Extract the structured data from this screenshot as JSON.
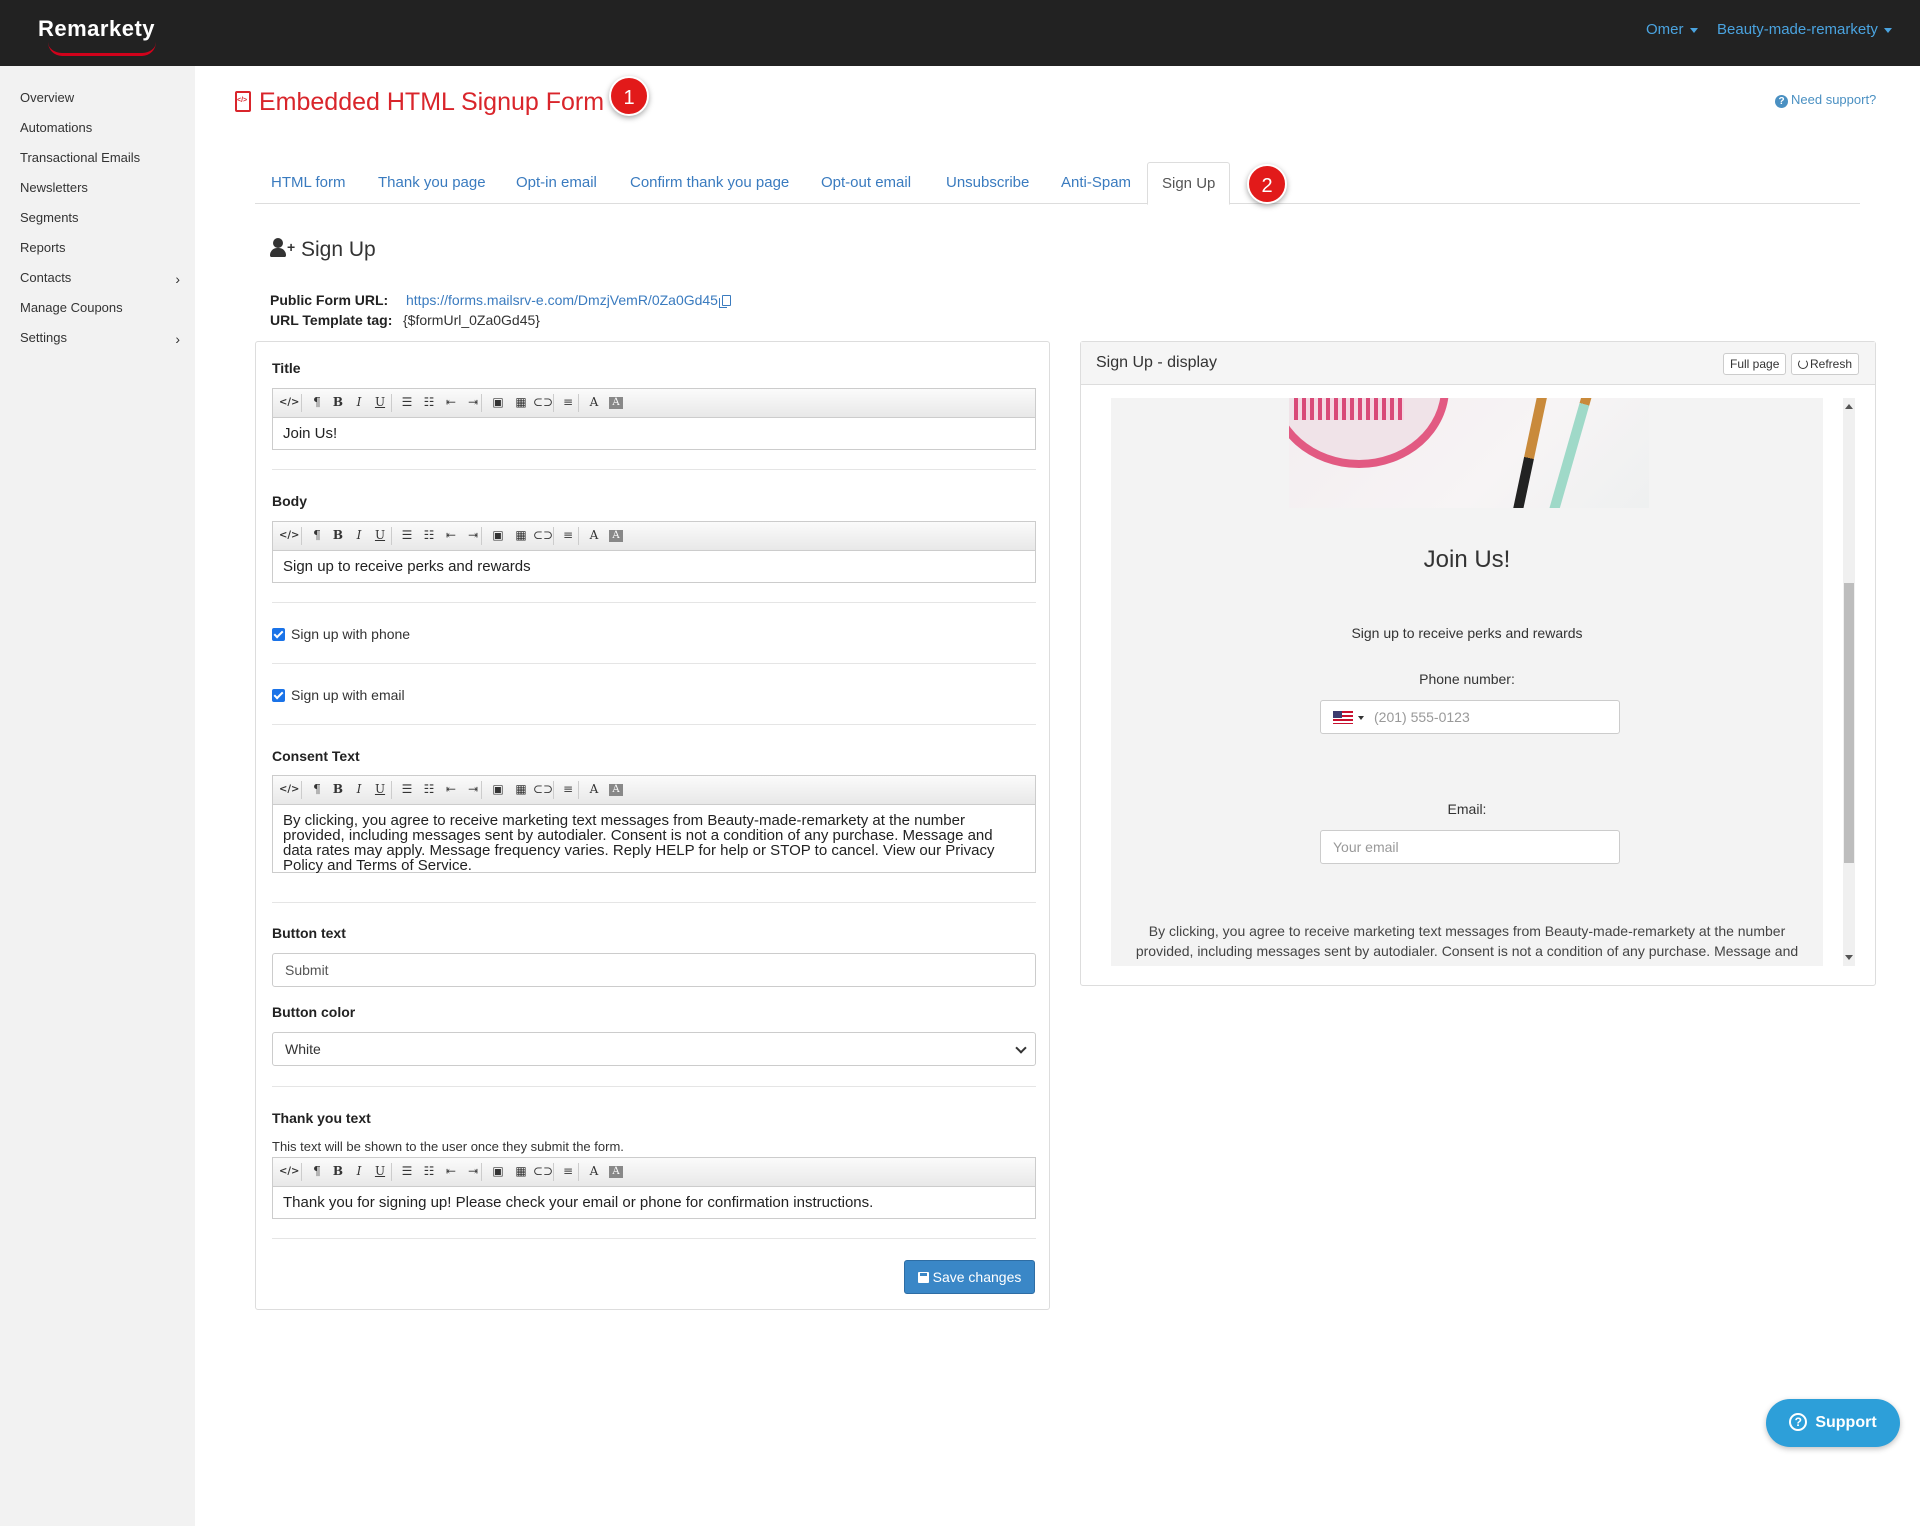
{
  "topbar": {
    "logo": "Remarkety",
    "user": "Omer",
    "account": "Beauty-made-remarkety"
  },
  "sidebar": {
    "items": [
      {
        "label": "Overview"
      },
      {
        "label": "Automations"
      },
      {
        "label": "Transactional Emails"
      },
      {
        "label": "Newsletters"
      },
      {
        "label": "Segments"
      },
      {
        "label": "Reports"
      },
      {
        "label": "Contacts",
        "chevron": "›"
      },
      {
        "label": "Manage Coupons"
      },
      {
        "label": "Settings",
        "chevron": "›"
      }
    ]
  },
  "header": {
    "title": "Embedded HTML Signup Form",
    "need_support": "Need support?",
    "badge1": "1",
    "badge2": "2"
  },
  "tabs": [
    {
      "label": "HTML form"
    },
    {
      "label": "Thank you page"
    },
    {
      "label": "Opt-in email"
    },
    {
      "label": "Confirm thank you page"
    },
    {
      "label": "Opt-out email"
    },
    {
      "label": "Unsubscribe"
    },
    {
      "label": "Anti-Spam"
    },
    {
      "label": "Sign Up",
      "active": true
    }
  ],
  "section": {
    "title": "Sign Up",
    "public_form_url_label": "Public Form URL:",
    "public_form_url": "https://forms.mailsrv-e.com/DmzjVemR/0Za0Gd45",
    "url_template_label": "URL Template tag:",
    "url_template": "{$formUrl_0Za0Gd45}"
  },
  "form": {
    "title_label": "Title",
    "title_value": "Join Us!",
    "body_label": "Body",
    "body_value": "Sign up to receive perks and rewards",
    "phone_checkbox": "Sign up with phone",
    "phone_checked": true,
    "email_checkbox": "Sign up with email",
    "email_checked": true,
    "consent_label": "Consent Text",
    "consent_value": "By clicking, you agree to receive marketing text messages from Beauty-made-remarkety at the number provided, including messages sent by autodialer. Consent is not a condition of any purchase. Message and data rates may apply. Message frequency varies. Reply HELP for help or STOP to cancel. View our Privacy Policy and Terms of Service.",
    "button_text_label": "Button text",
    "button_text_value": "Submit",
    "button_color_label": "Button color",
    "button_color_value": "White",
    "thank_you_label": "Thank you text",
    "thank_you_help": "This text will be shown to the user once they submit the form.",
    "thank_you_value": "Thank you for signing up! Please check your email or phone for confirmation instructions.",
    "save_label": "Save changes"
  },
  "toolbar_icons": [
    "</>",
    "¶",
    "B",
    "I",
    "U",
    "☰",
    "☷",
    "⇤",
    "⇥",
    "▣",
    "▦",
    "⊂⊃",
    "≡",
    "A",
    "A"
  ],
  "preview": {
    "title": "Sign Up - display",
    "full_page": "Full page",
    "refresh": "Refresh",
    "heading": "Join Us!",
    "body": "Sign up to receive perks and rewards",
    "phone_label": "Phone number:",
    "phone_placeholder": "(201) 555-0123",
    "email_label": "Email:",
    "email_placeholder": "Your email",
    "consent": "By clicking, you agree to receive marketing text messages from Beauty-made-remarkety at the number provided, including messages sent by autodialer. Consent is not a condition of any purchase. Message and data rates may apply."
  },
  "support_button": "Support",
  "colors": {
    "brand_red": "#d9252b",
    "link_blue": "#3a7bbf",
    "primary_button": "#3a87c7",
    "support_button": "#2d9fd9"
  }
}
